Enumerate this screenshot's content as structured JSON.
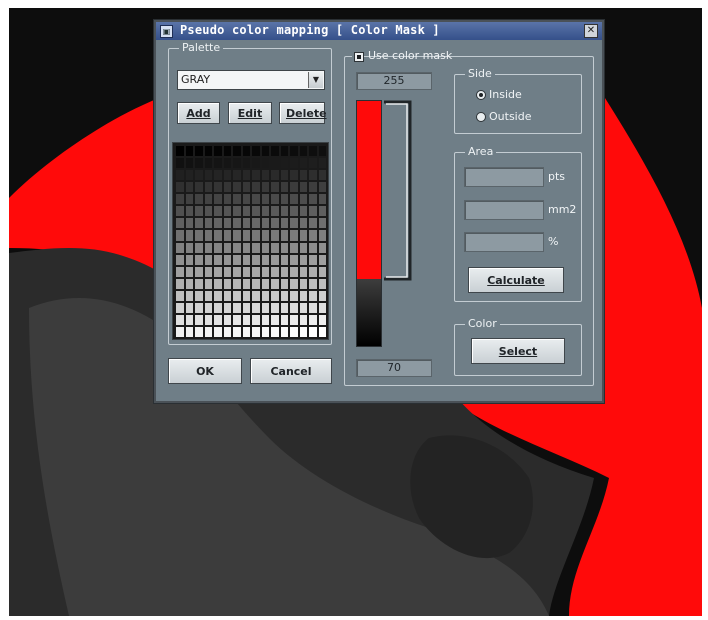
{
  "dialog": {
    "title": "Pseudo color mapping [ Color Mask ]",
    "close_glyph": "✕",
    "app_icon": "app-icon"
  },
  "palette": {
    "legend": "Palette",
    "selected": "GRAY",
    "add_label": "Add",
    "edit_label": "Edit",
    "delete_label": "Delete",
    "rows": 16,
    "cols": 16
  },
  "mask": {
    "use_color_mask_label": "Use color mask",
    "use_color_mask_checked": true,
    "upper_value": "255",
    "lower_value": "70",
    "upper_level": 255,
    "lower_level": 70,
    "mask_color": "#ff0a0a"
  },
  "side": {
    "legend": "Side",
    "inside_label": "Inside",
    "outside_label": "Outside",
    "selected": "Inside"
  },
  "area": {
    "legend": "Area",
    "units": [
      "pts",
      "mm2",
      "%"
    ],
    "values": [
      "",
      "",
      ""
    ],
    "calculate_label": "Calculate"
  },
  "color": {
    "legend": "Color",
    "select_label": "Select"
  },
  "footer": {
    "ok_label": "OK",
    "cancel_label": "Cancel"
  }
}
